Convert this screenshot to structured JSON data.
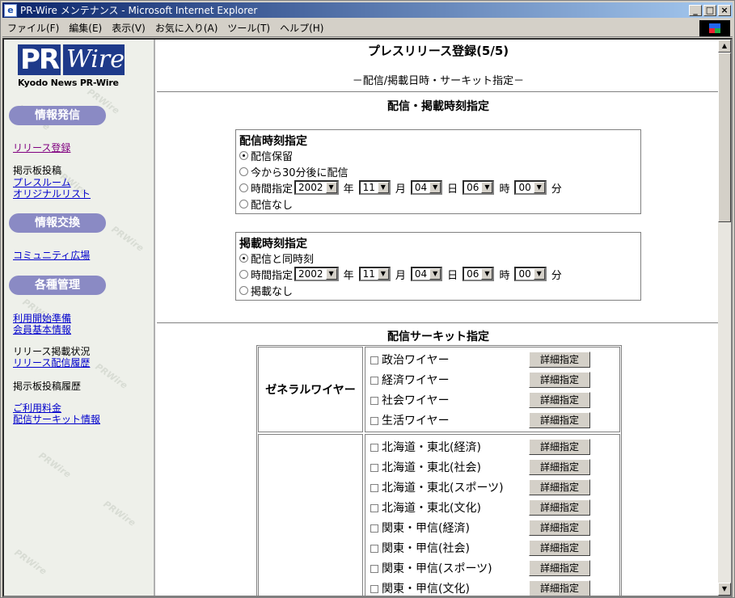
{
  "window": {
    "title": "PR-Wire メンテナンス - Microsoft Internet Explorer",
    "app_icon": "ie-icon"
  },
  "menubar": [
    "ファイル(F)",
    "編集(E)",
    "表示(V)",
    "お気に入り(A)",
    "ツール(T)",
    "ヘルプ(H)"
  ],
  "logo": {
    "pr": "PR",
    "wire": "Wire",
    "tagline": "Kyodo News PR-Wire"
  },
  "sidebar": {
    "sec1": "情報発信",
    "release_register": "リリース登録",
    "bbs_post": "掲示板投稿",
    "pressroom": "プレスルーム",
    "original_list": "オリジナルリスト",
    "sec2": "情報交換",
    "community": "コミュニティ広場",
    "sec3": "各種管理",
    "prep": "利用開始準備",
    "member_info": "会員基本情報",
    "release_status": "リリース掲載状況",
    "release_history": "リリース配信履歴",
    "bbs_history": "掲示板投稿履歴",
    "fee": "ご利用料金",
    "circuit_info": "配信サーキット情報"
  },
  "page": {
    "title": "プレスリリース登録(5/5)",
    "subtitle": "－配信/掲載日時・サーキット指定－",
    "time_section": "配信・掲載時刻指定",
    "circuit_section": "配信サーキット指定"
  },
  "delivery": {
    "legend": "配信時刻指定",
    "opt_hold": "配信保留",
    "opt_30min": "今から30分後に配信",
    "opt_time": "時間指定",
    "opt_none": "配信なし",
    "selected": "hold",
    "year": "2002",
    "month": "11",
    "day": "04",
    "hour": "06",
    "minute": "00"
  },
  "publish": {
    "legend": "掲載時刻指定",
    "opt_same": "配信と同時刻",
    "opt_time": "時間指定",
    "opt_none": "掲載なし",
    "selected": "same",
    "year": "2002",
    "month": "11",
    "day": "04",
    "hour": "06",
    "minute": "00"
  },
  "units": {
    "year": "年",
    "month": "月",
    "day": "日",
    "hour": "時",
    "minute": "分"
  },
  "circuits": {
    "general": {
      "name": "ゼネラルワイヤー",
      "items": [
        "政治ワイヤー",
        "経済ワイヤー",
        "社会ワイヤー",
        "生活ワイヤー"
      ]
    },
    "regional": {
      "name": "",
      "items": [
        "北海道・東北(経済)",
        "北海道・東北(社会)",
        "北海道・東北(スポーツ)",
        "北海道・東北(文化)",
        "関東・甲信(経済)",
        "関東・甲信(社会)",
        "関東・甲信(スポーツ)",
        "関東・甲信(文化)"
      ]
    },
    "detail_button": "詳細指定"
  }
}
